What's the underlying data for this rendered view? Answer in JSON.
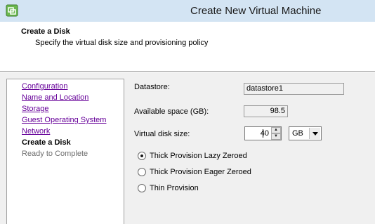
{
  "window": {
    "title": "Create New Virtual Machine",
    "icon": "vm-app-icon"
  },
  "header": {
    "step_title": "Create a Disk",
    "step_description": "Specify the virtual disk size and provisioning policy"
  },
  "nav": {
    "items": [
      {
        "label": "Configuration",
        "state": "link"
      },
      {
        "label": "Name and Location",
        "state": "link"
      },
      {
        "label": "Storage",
        "state": "link"
      },
      {
        "label": "Guest Operating System",
        "state": "link"
      },
      {
        "label": "Network",
        "state": "link"
      },
      {
        "label": "Create a Disk",
        "state": "current"
      },
      {
        "label": "Ready to Complete",
        "state": "pending"
      }
    ]
  },
  "form": {
    "datastore_label": "Datastore:",
    "datastore_value": "datastore1",
    "available_label": "Available space (GB):",
    "available_value": "98.5",
    "disk_size_label": "Virtual disk size:",
    "disk_size_value": "40",
    "unit_value": "GB",
    "provisioning": [
      {
        "label": "Thick Provision Lazy Zeroed",
        "checked": true
      },
      {
        "label": "Thick Provision Eager Zeroed",
        "checked": false
      },
      {
        "label": "Thin Provision",
        "checked": false
      }
    ]
  },
  "colors": {
    "titlebar": "#d3e4f3",
    "link": "#660099",
    "body_bg": "#f0f0f0",
    "icon_green": "#4a9a3a"
  }
}
